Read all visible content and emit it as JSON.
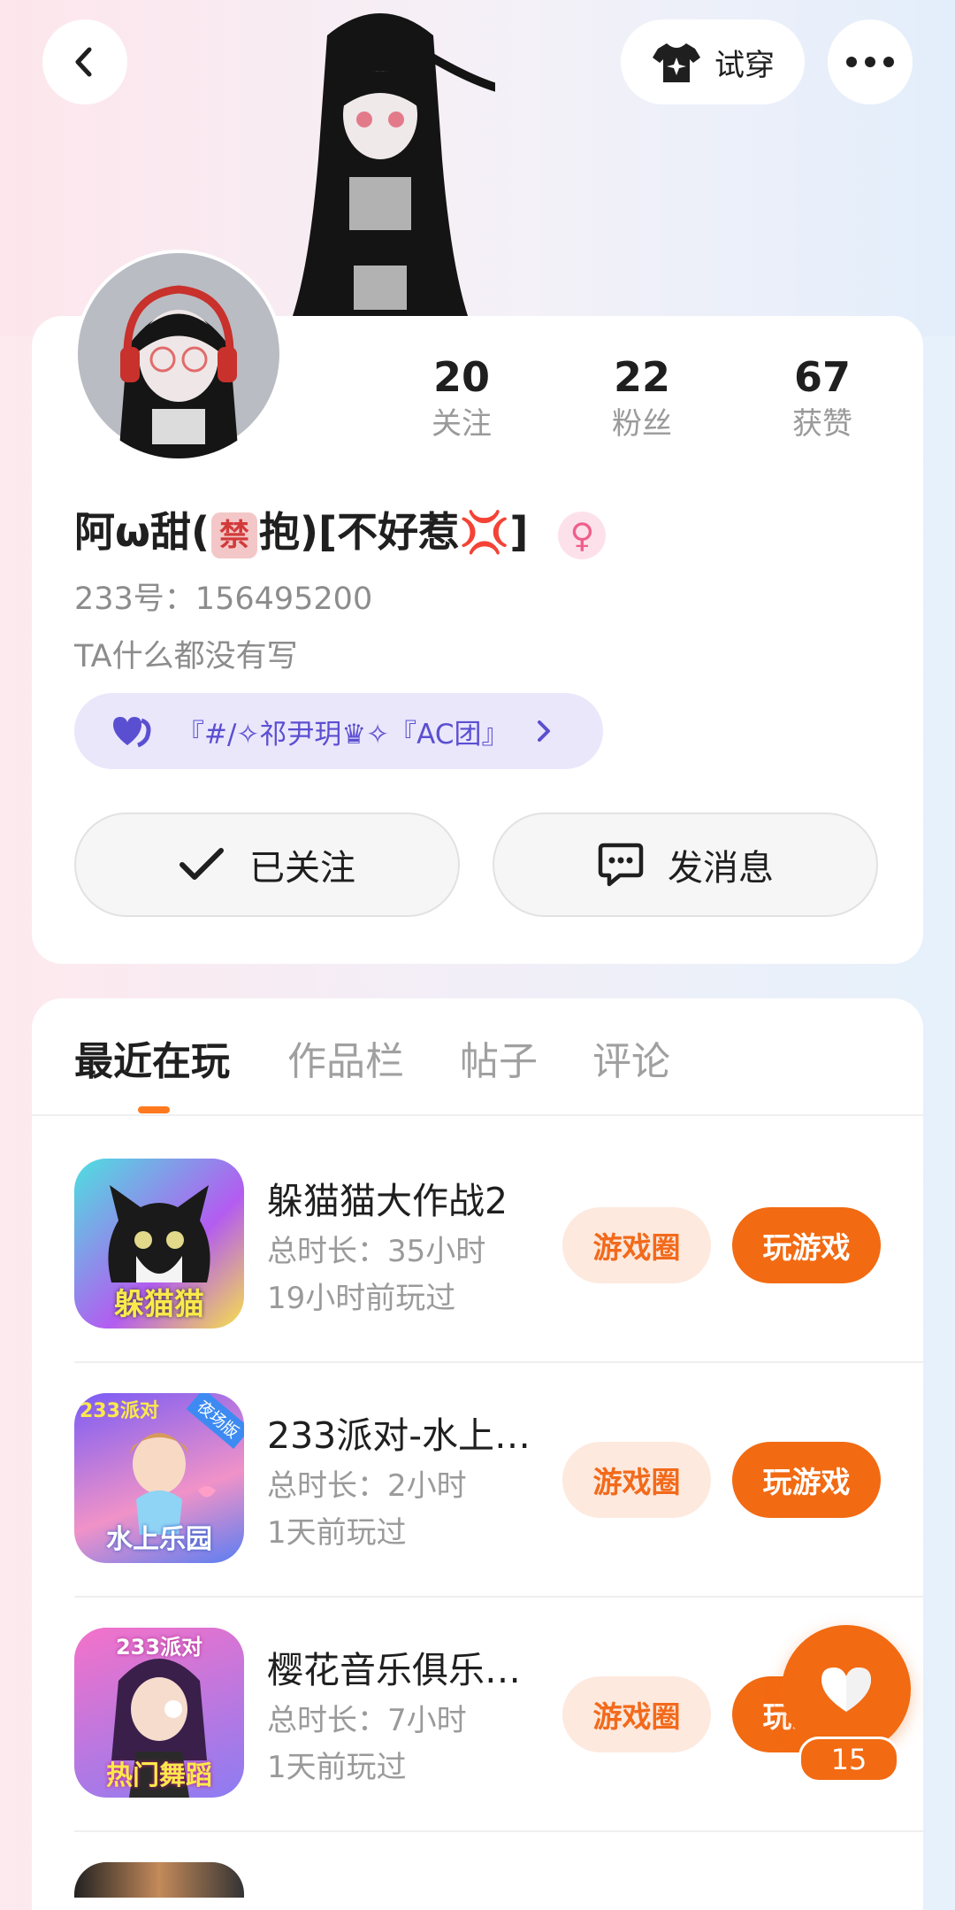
{
  "header": {
    "try_on_label": "试穿"
  },
  "stats": [
    {
      "value": "20",
      "label": "关注"
    },
    {
      "value": "22",
      "label": "粉丝"
    },
    {
      "value": "67",
      "label": "获赞"
    }
  ],
  "profile": {
    "name_part1": "阿ω甜(",
    "name_badge": "禁",
    "name_part2": "抱)[不好惹",
    "name_emoji": "💢",
    "name_part3": "]",
    "gender_icon": "♀",
    "id_text": "233号：156495200",
    "bio": "TA什么都没有写",
    "group_name": "『#/✧祁尹玥♛✧『AC团』"
  },
  "actions": {
    "follow_label": "已关注",
    "message_label": "发消息"
  },
  "tabs": [
    {
      "label": "最近在玩"
    },
    {
      "label": "作品栏"
    },
    {
      "label": "帖子"
    },
    {
      "label": "评论"
    }
  ],
  "games": [
    {
      "title": "躲猫猫大作战2",
      "duration": "总时长：35小时",
      "last_played": "19小时前玩过",
      "icon_text": "躲猫猫",
      "circle_label": "游戏圈",
      "play_label": "玩游戏"
    },
    {
      "title": "233派对-水上…",
      "duration": "总时长：2小时",
      "last_played": "1天前玩过",
      "icon_text": "水上乐园",
      "icon_corner": "233派对",
      "icon_badge": "夜场版",
      "circle_label": "游戏圈",
      "play_label": "玩游戏"
    },
    {
      "title": "樱花音乐俱乐…",
      "duration": "总时长：7小时",
      "last_played": "1天前玩过",
      "icon_text": "热门舞蹈",
      "icon_corner": "233派对",
      "circle_label": "游戏圈",
      "play_label": "玩游戏"
    }
  ],
  "fab": {
    "count": "15"
  },
  "colors": {
    "accent": "#f26a12",
    "accent_light": "#fde9de",
    "group_bg": "#eae7fb",
    "group_text": "#5b4fd1"
  }
}
